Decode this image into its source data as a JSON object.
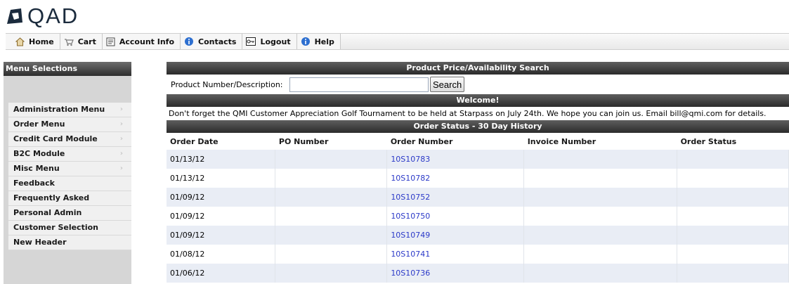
{
  "app": {
    "logo_text": "QAD"
  },
  "nav": [
    {
      "label": "Home",
      "icon": "home-icon"
    },
    {
      "label": "Cart",
      "icon": "cart-icon"
    },
    {
      "label": "Account Info",
      "icon": "account-info-icon"
    },
    {
      "label": "Contacts",
      "icon": "contacts-icon"
    },
    {
      "label": "Logout",
      "icon": "logout-icon"
    },
    {
      "label": "Help",
      "icon": "help-icon"
    }
  ],
  "sidebar": {
    "title": "Menu Selections",
    "items": [
      {
        "label": "Administration Menu",
        "has_submenu": true
      },
      {
        "label": "Order Menu",
        "has_submenu": true
      },
      {
        "label": "Credit Card Module",
        "has_submenu": true
      },
      {
        "label": "B2C Module",
        "has_submenu": true
      },
      {
        "label": "Misc Menu",
        "has_submenu": true
      },
      {
        "label": "Feedback",
        "has_submenu": false
      },
      {
        "label": "Frequently Asked",
        "has_submenu": false
      },
      {
        "label": "Personal Admin",
        "has_submenu": false
      },
      {
        "label": "Customer Selection",
        "has_submenu": false
      },
      {
        "label": "New Header",
        "has_submenu": false
      }
    ],
    "submenu_glyph": "›"
  },
  "search": {
    "title": "Product Price/Availability Search",
    "label": "Product Number/Description:",
    "value": "",
    "button_label": "Search"
  },
  "welcome": {
    "title": "Welcome!",
    "message": "Don't forget the QMI Customer Appreciation Golf Tournament to be held at Starpass on July 24th. We hope you can join us. Email bill@qmi.com for details."
  },
  "orders": {
    "title": "Order Status - 30 Day History",
    "columns": [
      "Order Date",
      "PO Number",
      "Order Number",
      "Invoice Number",
      "Order Status"
    ],
    "rows": [
      {
        "date": "01/13/12",
        "po": "",
        "order": "10S10783",
        "invoice": "",
        "status": ""
      },
      {
        "date": "01/13/12",
        "po": "",
        "order": "10S10782",
        "invoice": "",
        "status": ""
      },
      {
        "date": "01/09/12",
        "po": "",
        "order": "10S10752",
        "invoice": "",
        "status": ""
      },
      {
        "date": "01/09/12",
        "po": "",
        "order": "10S10750",
        "invoice": "",
        "status": ""
      },
      {
        "date": "01/09/12",
        "po": "",
        "order": "10S10749",
        "invoice": "",
        "status": ""
      },
      {
        "date": "01/08/12",
        "po": "",
        "order": "10S10741",
        "invoice": "",
        "status": ""
      },
      {
        "date": "01/06/12",
        "po": "",
        "order": "10S10736",
        "invoice": "",
        "status": ""
      }
    ]
  },
  "colors": {
    "header_bar": "#2b2b2b",
    "link": "#2b39c8",
    "row_alt": "#e9edf5",
    "sidebar_bg": "#d6d6d6"
  }
}
